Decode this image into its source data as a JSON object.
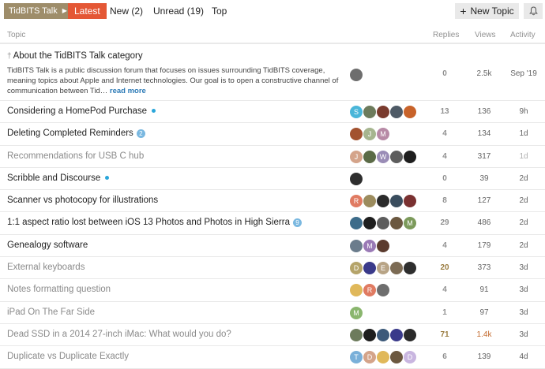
{
  "nav": {
    "category": "TidBITS Talk",
    "latest": "Latest",
    "new": "New (2)",
    "unread": "Unread (19)",
    "top": "Top",
    "new_topic": "New Topic"
  },
  "columns": {
    "topic": "Topic",
    "replies": "Replies",
    "views": "Views",
    "activity": "Activity"
  },
  "topics": [
    {
      "title": "About the TidBITS Talk category",
      "pinned": true,
      "excerpt": "TidBITS Talk is a public discussion forum that focuses on issues surrounding TidBITS coverage, meaning topics about Apple and Internet technologies. Our goal is to open a constructive channel of communication between Tid…",
      "read_more": "read more",
      "replies": "0",
      "views": "2.5k",
      "activity": "Sep '19",
      "avatars": [
        {
          "c": "#6e6e6e",
          "t": ""
        }
      ]
    },
    {
      "title": "Considering a HomePod Purchase",
      "new_dot": true,
      "replies": "13",
      "views": "136",
      "activity": "9h",
      "avatars": [
        {
          "c": "#4ab6d9",
          "t": "S"
        },
        {
          "c": "#6d7b5c",
          "t": ""
        },
        {
          "c": "#7a3b2e",
          "t": ""
        },
        {
          "c": "#4e5a66",
          "t": ""
        },
        {
          "c": "#c8632a",
          "t": ""
        }
      ]
    },
    {
      "title": "Deleting Completed Reminders",
      "badge": "2",
      "replies": "4",
      "views": "134",
      "activity": "1d",
      "avatars": [
        {
          "c": "#a2522f",
          "t": ""
        },
        {
          "c": "#a6b58f",
          "t": "J"
        },
        {
          "c": "#b78aa6",
          "t": "M"
        }
      ]
    },
    {
      "title": "Recommendations for USB C hub",
      "visited": true,
      "replies": "4",
      "views": "317",
      "activity": "1d",
      "activity_old": true,
      "avatars": [
        {
          "c": "#d4a48a",
          "t": "J"
        },
        {
          "c": "#5b6b47",
          "t": ""
        },
        {
          "c": "#9a8cb6",
          "t": "W"
        },
        {
          "c": "#5d5d5d",
          "t": ""
        },
        {
          "c": "#1e1e1e",
          "t": ""
        }
      ]
    },
    {
      "title": "Scribble and Discourse",
      "new_dot": true,
      "replies": "0",
      "views": "39",
      "activity": "2d",
      "avatars": [
        {
          "c": "#2e2e2e",
          "t": ""
        }
      ]
    },
    {
      "title": "Scanner vs photocopy for illustrations",
      "replies": "8",
      "views": "127",
      "activity": "2d",
      "avatars": [
        {
          "c": "#e07b62",
          "t": "R"
        },
        {
          "c": "#9c8c5e",
          "t": ""
        },
        {
          "c": "#2b2b2b",
          "t": ""
        },
        {
          "c": "#3a4d5e",
          "t": ""
        },
        {
          "c": "#7a3131",
          "t": ""
        }
      ]
    },
    {
      "title": "1:1 aspect ratio lost between iOS 13 Photos and Photos in High Sierra",
      "badge": "9",
      "replies": "29",
      "views": "486",
      "activity": "2d",
      "avatars": [
        {
          "c": "#3d6c8a",
          "t": ""
        },
        {
          "c": "#1e1e1e",
          "t": ""
        },
        {
          "c": "#5d5d5d",
          "t": ""
        },
        {
          "c": "#6b5840",
          "t": ""
        },
        {
          "c": "#7c9a5b",
          "t": "M"
        }
      ]
    },
    {
      "title": "Genealogy software",
      "replies": "4",
      "views": "179",
      "activity": "2d",
      "avatars": [
        {
          "c": "#6b7c8c",
          "t": ""
        },
        {
          "c": "#9a7ab6",
          "t": "M"
        },
        {
          "c": "#5b3b2e",
          "t": ""
        }
      ]
    },
    {
      "title": "External keyboards",
      "visited": true,
      "replies": "20",
      "replies_hot": true,
      "views": "373",
      "activity": "3d",
      "avatars": [
        {
          "c": "#b5a46a",
          "t": "D"
        },
        {
          "c": "#3a3a8a",
          "t": ""
        },
        {
          "c": "#b8a486",
          "t": "E"
        },
        {
          "c": "#7c6b54",
          "t": ""
        },
        {
          "c": "#2e2e2e",
          "t": ""
        }
      ]
    },
    {
      "title": "Notes formatting question",
      "visited": true,
      "replies": "4",
      "views": "91",
      "activity": "3d",
      "avatars": [
        {
          "c": "#e0b85a",
          "t": ""
        },
        {
          "c": "#e07b62",
          "t": "R"
        },
        {
          "c": "#6e6e6e",
          "t": ""
        }
      ]
    },
    {
      "title": "iPad On The Far Side",
      "visited": true,
      "replies": "1",
      "views": "97",
      "activity": "3d",
      "avatars": [
        {
          "c": "#8ab66e",
          "t": "M"
        }
      ]
    },
    {
      "title": "Dead SSD in a 2014 27-inch iMac: What would you do?",
      "visited": true,
      "replies": "71",
      "replies_hot": true,
      "views": "1.4k",
      "views_hot": true,
      "activity": "3d",
      "avatars": [
        {
          "c": "#6d7b5c",
          "t": ""
        },
        {
          "c": "#1e1e1e",
          "t": ""
        },
        {
          "c": "#3d5a7a",
          "t": ""
        },
        {
          "c": "#3a3a8a",
          "t": ""
        },
        {
          "c": "#2b2b2b",
          "t": ""
        }
      ]
    },
    {
      "title": "Duplicate vs Duplicate Exactly",
      "visited": true,
      "replies": "6",
      "views": "139",
      "activity": "4d",
      "avatars": [
        {
          "c": "#7ab0d9",
          "t": "T"
        },
        {
          "c": "#d4a48a",
          "t": "D"
        },
        {
          "c": "#e0b85a",
          "t": ""
        },
        {
          "c": "#6b5840",
          "t": ""
        },
        {
          "c": "#c9b6e0",
          "t": "D"
        }
      ]
    }
  ]
}
